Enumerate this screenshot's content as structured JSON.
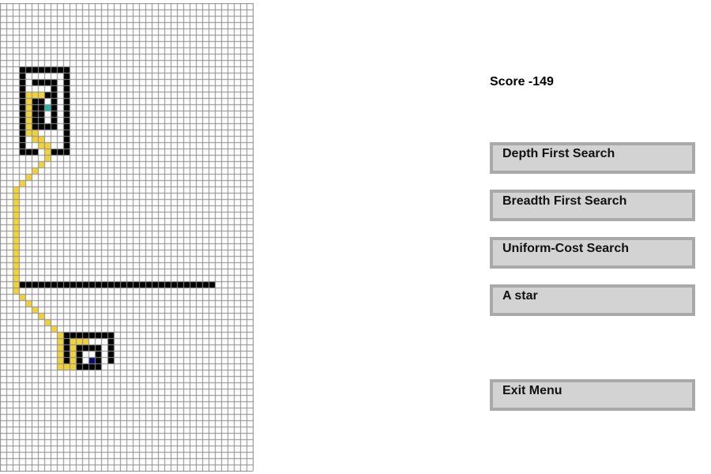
{
  "score": {
    "label": "Score",
    "value": "-149"
  },
  "menu": {
    "dfs_label": "Depth First Search",
    "bfs_label": "Breadth First Search",
    "ucs_label": "Uniform-Cost Search",
    "astar_label": "A star",
    "exit_label": "Exit Menu"
  },
  "colors": {
    "background": "#ffffff",
    "grid_line": "#8c8c8c",
    "wall": "#000000",
    "path": "#f0d23c",
    "start": "#2ab5a5",
    "goal": "#0a0a6e",
    "button_fill": "#d3d3d3",
    "button_border": "#a9a9a9"
  }
}
